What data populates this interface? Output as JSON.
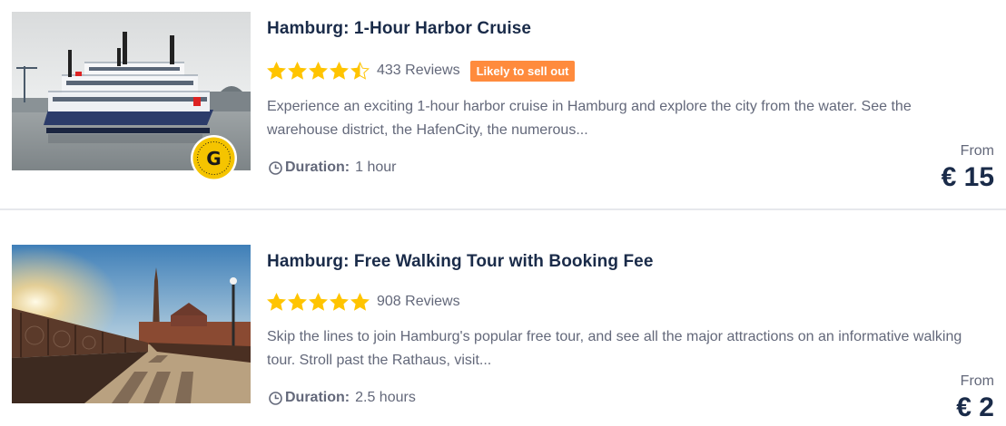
{
  "activities": [
    {
      "title": "Hamburg: 1-Hour Harbor Cruise",
      "rating_value": 4.5,
      "reviews": "433 Reviews",
      "badge": "Likely to sell out",
      "description": "Experience an exciting 1-hour harbor cruise in Hamburg and explore the city from the water. See the warehouse district, the HafenCity, the numerous...",
      "duration_label": "Duration:",
      "duration_value": "1 hour",
      "from_label": "From",
      "price": "€ 15",
      "image": "paddle-steamer-harbor-photo",
      "provider_icon": "getyourguide-badge-icon"
    },
    {
      "title": "Hamburg: Free Walking Tour with Booking Fee",
      "rating_value": 5,
      "reviews": "908 Reviews",
      "description": "Skip the lines to join Hamburg's popular free tour, and see all the major attractions on an informative walking tour. Stroll past the Rathaus, visit...",
      "duration_label": "Duration:",
      "duration_value": "2.5 hours",
      "from_label": "From",
      "price": "€ 2",
      "image": "speicherstadt-bridge-sunset-photo"
    }
  ],
  "colors": {
    "star": "#ffc400",
    "badge_bg": "#ff8b3d",
    "title": "#1a2b49",
    "muted": "#63687a",
    "provider_badge": "#f5c400"
  }
}
